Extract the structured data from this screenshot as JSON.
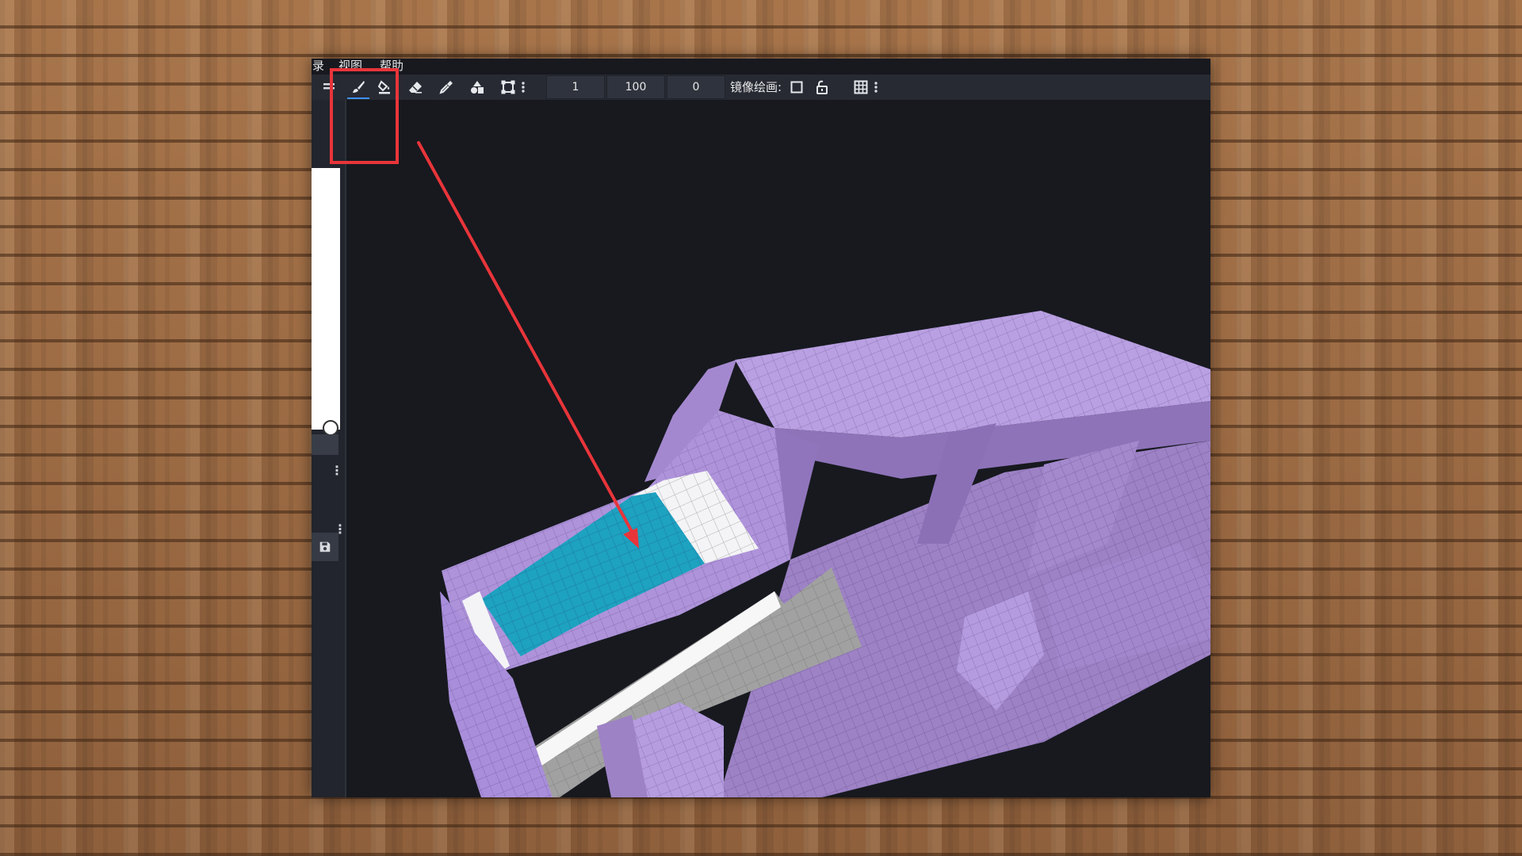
{
  "menu": {
    "item_record": "录",
    "item_view": "视图",
    "item_help": "帮助"
  },
  "toolbar": {
    "tools": [
      "brush-icon",
      "fill-bucket-icon",
      "eraser-icon",
      "color-picker-icon",
      "shape-tool-icon",
      "transform-icon"
    ],
    "active_tool": "brush-icon",
    "size_value": "1",
    "opacity_value": "100",
    "softness_value": "0",
    "mirror_label": "镜像绘画:"
  },
  "colors": {
    "annotation_red": "#e8353a",
    "model_purple": "#b79adf",
    "model_cyan": "#18a0bd",
    "viewport_bg": "#17191f",
    "toolbar_bg": "#272a33"
  }
}
